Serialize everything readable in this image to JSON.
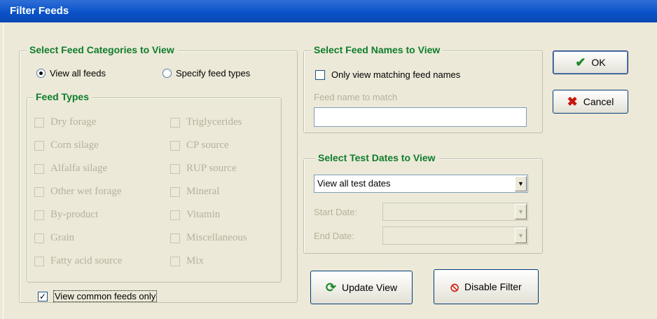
{
  "window": {
    "title": "Filter Feeds"
  },
  "categories": {
    "legend": "Select Feed Categories to View",
    "view_all_label": "View all feeds",
    "view_all_selected": true,
    "specify_label": "Specify feed types",
    "feed_types_legend": "Feed Types",
    "left": [
      "Dry forage",
      "Corn silage",
      "Alfalfa silage",
      "Other wet forage",
      "By-product",
      "Grain",
      "Fatty acid source"
    ],
    "right": [
      "Triglycerides",
      "CP source",
      "RUP source",
      "Mineral",
      "Vitamin",
      "Miscellaneous",
      "Mix"
    ],
    "common_label": "View common feeds only",
    "common_checked": true
  },
  "names": {
    "legend": "Select Feed Names to View",
    "only_matching_label": "Only view matching feed names",
    "match_label": "Feed name to match",
    "match_value": ""
  },
  "dates": {
    "legend": "Select Test Dates to View",
    "selected": "View all test dates",
    "start_label": "Start Date:",
    "end_label": "End Date:",
    "start_value": "",
    "end_value": ""
  },
  "buttons": {
    "ok": "OK",
    "cancel": "Cancel",
    "update": "Update View",
    "disable": "Disable Filter"
  },
  "icons": {
    "ok": "checkmark-icon",
    "cancel": "x-icon",
    "update": "refresh-icon",
    "disable": "prohibited-icon"
  }
}
